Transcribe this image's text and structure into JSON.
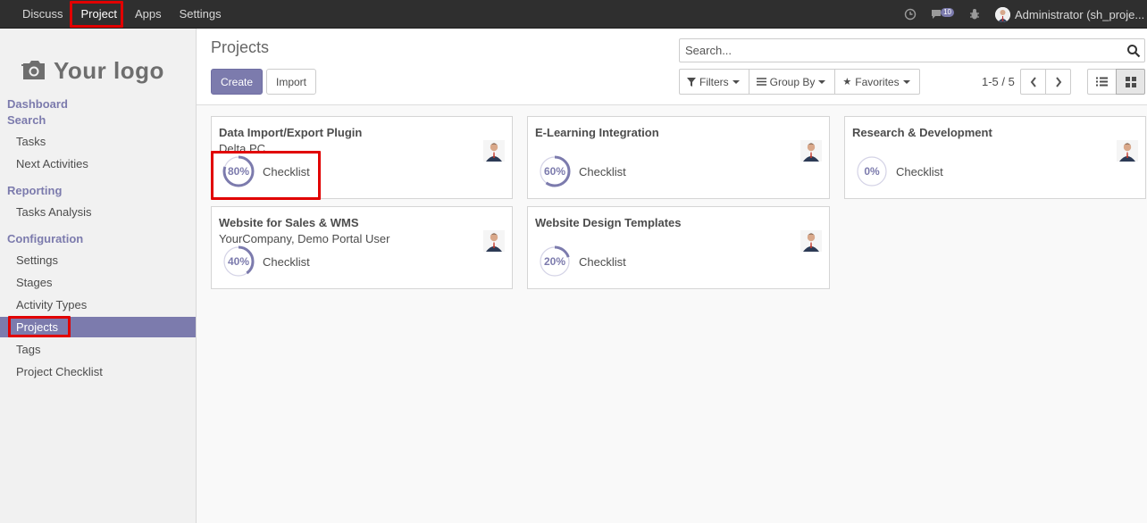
{
  "topbar": {
    "menu": [
      "Discuss",
      "Project",
      "Apps",
      "Settings"
    ],
    "active": "Project",
    "chat_count": "10",
    "user": "Administrator (sh_proje..."
  },
  "sidebar": {
    "logo_text": "Your logo",
    "sections": [
      {
        "title": "Dashboard",
        "items": []
      },
      {
        "title": "Search",
        "items": [
          "Tasks",
          "Next Activities"
        ]
      },
      {
        "title": "Reporting",
        "items": [
          "Tasks Analysis"
        ]
      },
      {
        "title": "Configuration",
        "items": [
          "Settings",
          "Stages",
          "Activity Types",
          "Projects",
          "Tags",
          "Project Checklist"
        ]
      }
    ],
    "active_item": "Projects"
  },
  "control": {
    "title": "Projects",
    "create_label": "Create",
    "import_label": "Import",
    "search_placeholder": "Search...",
    "filters_label": "Filters",
    "groupby_label": "Group By",
    "favorites_label": "Favorites",
    "pager": "1-5 / 5"
  },
  "cards": [
    {
      "name": "Data Import/Export Plugin",
      "partner": "Delta PC",
      "progress": 80,
      "progress_label": "80%",
      "check_label": "Checklist"
    },
    {
      "name": "E-Learning Integration",
      "partner": "",
      "progress": 60,
      "progress_label": "60%",
      "check_label": "Checklist"
    },
    {
      "name": "Research & Development",
      "partner": "",
      "progress": 0,
      "progress_label": "0%",
      "check_label": "Checklist"
    },
    {
      "name": "Website for Sales & WMS",
      "partner": "YourCompany, Demo Portal User",
      "progress": 40,
      "progress_label": "40%",
      "check_label": "Checklist"
    },
    {
      "name": "Website Design Templates",
      "partner": "",
      "progress": 20,
      "progress_label": "20%",
      "check_label": "Checklist"
    }
  ],
  "colors": {
    "accent": "#7c7bad",
    "topbar": "#2f2f2f",
    "highlight": "#e10000"
  }
}
